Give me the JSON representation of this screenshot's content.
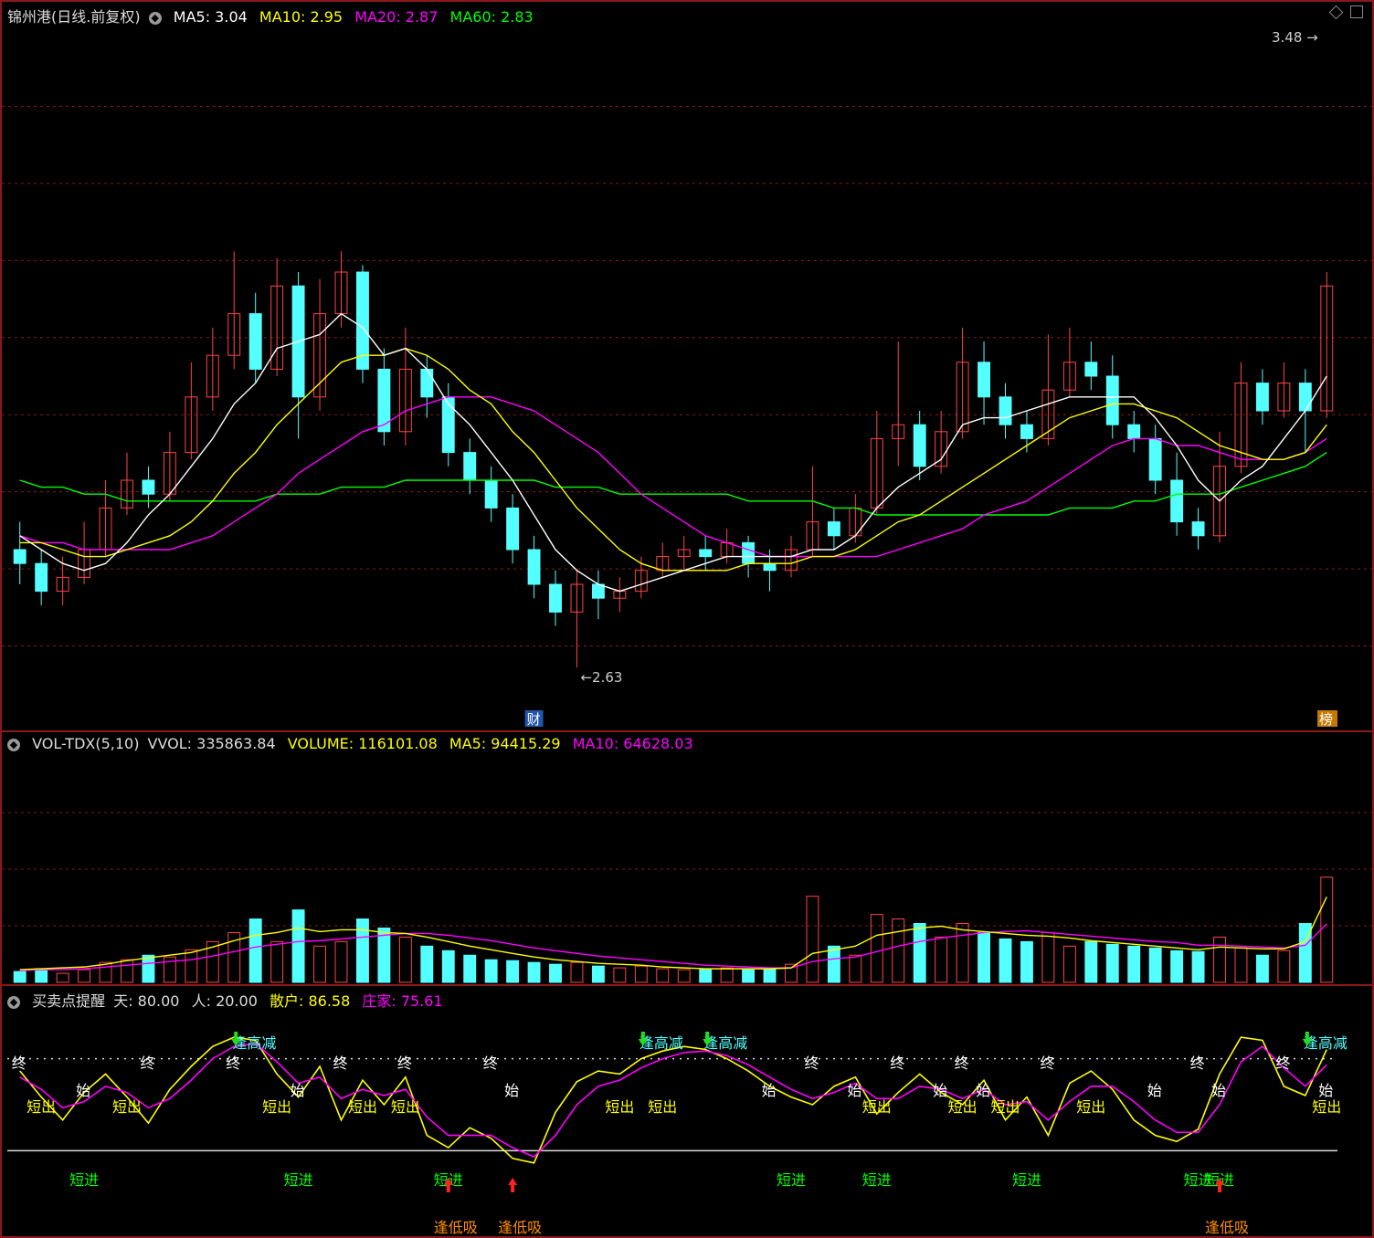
{
  "colors": {
    "up": "#ff4444",
    "down": "#54ffff",
    "ma5": "#ffffff",
    "ma10": "#ffff00",
    "ma20": "#ff00ff",
    "ma60": "#00ff00",
    "grid": "#8a1a1a",
    "vol_ma5": "#ffff00",
    "vol_ma10": "#ff00ff",
    "tian": "#ffff00",
    "ren": "#ff00ff",
    "signal_exit": "#ffff00",
    "signal_entry": "#00ff00",
    "signal_low": "#ff8c00"
  },
  "header": {
    "title": "锦州港(日线.前复权)",
    "ma5": "MA5: 3.04",
    "ma10": "MA10: 2.95",
    "ma20": "MA20: 2.87",
    "ma60": "MA60: 2.83"
  },
  "price_panel": {
    "high_label": "3.48",
    "low_label": "2.63",
    "badge_cai": "财",
    "badge_bang": "榜"
  },
  "volume_header": {
    "name": "VOL-TDX(5,10)",
    "vvol": "VVOL: 335863.84",
    "volume": "VOLUME: 116101.08",
    "ma5": "MA5: 94415.29",
    "ma10": "MA10: 64628.03"
  },
  "indicator_header": {
    "name": "买卖点提醒",
    "tian": "天: 80.00",
    "ren": "人: 20.00",
    "sanhu": "散户: 86.58",
    "zhuangjia": "庄家: 75.61"
  },
  "signal_labels": {
    "exit": "短出",
    "entry": "短进",
    "low_buy": "逢低吸",
    "high_reduce": "逢高减",
    "start": "始",
    "end": "终"
  },
  "chart_data": [
    {
      "type": "candlestick",
      "title": "锦州港(日线.前复权)",
      "ylim": [
        2.55,
        3.55
      ],
      "x_count": 62,
      "candles": [
        [
          2.8,
          2.78,
          2.84,
          2.75
        ],
        [
          2.78,
          2.74,
          2.8,
          2.72
        ],
        [
          2.74,
          2.76,
          2.79,
          2.72
        ],
        [
          2.76,
          2.8,
          2.84,
          2.75
        ],
        [
          2.8,
          2.86,
          2.9,
          2.79
        ],
        [
          2.86,
          2.9,
          2.94,
          2.85
        ],
        [
          2.9,
          2.88,
          2.92,
          2.86
        ],
        [
          2.88,
          2.94,
          2.97,
          2.87
        ],
        [
          2.94,
          3.02,
          3.07,
          2.93
        ],
        [
          3.02,
          3.08,
          3.12,
          3.0
        ],
        [
          3.08,
          3.14,
          3.23,
          3.06
        ],
        [
          3.14,
          3.06,
          3.17,
          3.04
        ],
        [
          3.06,
          3.18,
          3.22,
          3.05
        ],
        [
          3.18,
          3.02,
          3.2,
          2.96
        ],
        [
          3.02,
          3.14,
          3.19,
          3.0
        ],
        [
          3.14,
          3.2,
          3.23,
          3.12
        ],
        [
          3.2,
          3.06,
          3.21,
          3.04
        ],
        [
          3.06,
          2.97,
          3.09,
          2.95
        ],
        [
          2.97,
          3.06,
          3.12,
          2.95
        ],
        [
          3.06,
          3.02,
          3.08,
          2.99
        ],
        [
          3.02,
          2.94,
          3.04,
          2.92
        ],
        [
          2.94,
          2.9,
          2.96,
          2.88
        ],
        [
          2.9,
          2.86,
          2.92,
          2.84
        ],
        [
          2.86,
          2.8,
          2.88,
          2.78
        ],
        [
          2.8,
          2.75,
          2.82,
          2.73
        ],
        [
          2.75,
          2.71,
          2.77,
          2.69
        ],
        [
          2.71,
          2.75,
          2.77,
          2.63
        ],
        [
          2.75,
          2.73,
          2.77,
          2.7
        ],
        [
          2.73,
          2.74,
          2.76,
          2.71
        ],
        [
          2.74,
          2.77,
          2.79,
          2.73
        ],
        [
          2.77,
          2.79,
          2.81,
          2.76
        ],
        [
          2.79,
          2.8,
          2.82,
          2.77
        ],
        [
          2.8,
          2.79,
          2.82,
          2.77
        ],
        [
          2.79,
          2.81,
          2.83,
          2.78
        ],
        [
          2.81,
          2.78,
          2.82,
          2.76
        ],
        [
          2.78,
          2.77,
          2.8,
          2.74
        ],
        [
          2.77,
          2.8,
          2.82,
          2.76
        ],
        [
          2.8,
          2.84,
          2.92,
          2.79
        ],
        [
          2.84,
          2.82,
          2.86,
          2.8
        ],
        [
          2.82,
          2.86,
          2.88,
          2.81
        ],
        [
          2.86,
          2.96,
          3.0,
          2.85
        ],
        [
          2.96,
          2.98,
          3.1,
          2.92
        ],
        [
          2.98,
          2.92,
          3.0,
          2.9
        ],
        [
          2.92,
          2.97,
          3.0,
          2.91
        ],
        [
          2.97,
          3.07,
          3.12,
          2.96
        ],
        [
          3.07,
          3.02,
          3.1,
          2.98
        ],
        [
          3.02,
          2.98,
          3.04,
          2.96
        ],
        [
          2.98,
          2.96,
          3.0,
          2.94
        ],
        [
          2.96,
          3.03,
          3.11,
          2.95
        ],
        [
          3.03,
          3.07,
          3.12,
          3.02
        ],
        [
          3.07,
          3.05,
          3.1,
          3.03
        ],
        [
          3.05,
          2.98,
          3.08,
          2.96
        ],
        [
          2.98,
          2.96,
          3.0,
          2.94
        ],
        [
          2.96,
          2.9,
          2.98,
          2.88
        ],
        [
          2.9,
          2.84,
          2.94,
          2.82
        ],
        [
          2.84,
          2.82,
          2.86,
          2.8
        ],
        [
          2.82,
          2.92,
          2.97,
          2.81
        ],
        [
          2.92,
          3.04,
          3.07,
          2.91
        ],
        [
          3.04,
          3.0,
          3.06,
          2.98
        ],
        [
          3.0,
          3.04,
          3.07,
          2.99
        ],
        [
          3.04,
          3.0,
          3.06,
          2.94
        ],
        [
          3.0,
          3.18,
          3.2,
          2.99
        ]
      ],
      "ma5": [
        2.82,
        2.8,
        2.78,
        2.77,
        2.78,
        2.81,
        2.85,
        2.88,
        2.92,
        2.96,
        3.01,
        3.04,
        3.09,
        3.1,
        3.11,
        3.14,
        3.12,
        3.08,
        3.09,
        3.06,
        3.01,
        2.98,
        2.94,
        2.9,
        2.85,
        2.8,
        2.77,
        2.75,
        2.74,
        2.75,
        2.76,
        2.77,
        2.78,
        2.79,
        2.79,
        2.79,
        2.79,
        2.8,
        2.8,
        2.82,
        2.86,
        2.89,
        2.91,
        2.93,
        2.98,
        2.99,
        2.99,
        3.0,
        3.01,
        3.02,
        3.02,
        3.02,
        3.02,
        2.99,
        2.95,
        2.9,
        2.87,
        2.9,
        2.92,
        2.96,
        3.0,
        3.05
      ],
      "ma10": [
        2.81,
        2.81,
        2.8,
        2.79,
        2.79,
        2.8,
        2.81,
        2.82,
        2.84,
        2.87,
        2.91,
        2.94,
        2.98,
        3.01,
        3.04,
        3.07,
        3.08,
        3.08,
        3.09,
        3.08,
        3.06,
        3.03,
        3.01,
        2.97,
        2.94,
        2.9,
        2.86,
        2.83,
        2.8,
        2.78,
        2.77,
        2.77,
        2.77,
        2.77,
        2.78,
        2.78,
        2.78,
        2.79,
        2.79,
        2.8,
        2.82,
        2.84,
        2.85,
        2.87,
        2.89,
        2.91,
        2.93,
        2.95,
        2.97,
        2.99,
        3.0,
        3.01,
        3.01,
        3.0,
        2.99,
        2.97,
        2.95,
        2.94,
        2.93,
        2.93,
        2.94,
        2.98
      ],
      "ma20": [
        2.82,
        2.81,
        2.81,
        2.8,
        2.8,
        2.8,
        2.8,
        2.8,
        2.81,
        2.82,
        2.84,
        2.86,
        2.88,
        2.91,
        2.93,
        2.95,
        2.97,
        2.98,
        3.0,
        3.01,
        3.02,
        3.02,
        3.02,
        3.01,
        3.0,
        2.98,
        2.96,
        2.94,
        2.91,
        2.88,
        2.86,
        2.84,
        2.82,
        2.81,
        2.8,
        2.79,
        2.79,
        2.79,
        2.79,
        2.79,
        2.79,
        2.8,
        2.81,
        2.82,
        2.83,
        2.85,
        2.86,
        2.87,
        2.89,
        2.91,
        2.93,
        2.95,
        2.96,
        2.96,
        2.95,
        2.95,
        2.94,
        2.93,
        2.93,
        2.93,
        2.94,
        2.96
      ],
      "ma60": [
        2.9,
        2.89,
        2.89,
        2.88,
        2.88,
        2.87,
        2.87,
        2.87,
        2.87,
        2.87,
        2.87,
        2.87,
        2.88,
        2.88,
        2.88,
        2.89,
        2.89,
        2.89,
        2.9,
        2.9,
        2.9,
        2.9,
        2.9,
        2.9,
        2.9,
        2.89,
        2.89,
        2.89,
        2.88,
        2.88,
        2.88,
        2.88,
        2.88,
        2.88,
        2.87,
        2.87,
        2.87,
        2.87,
        2.86,
        2.86,
        2.85,
        2.85,
        2.85,
        2.85,
        2.85,
        2.85,
        2.85,
        2.85,
        2.85,
        2.86,
        2.86,
        2.86,
        2.87,
        2.87,
        2.88,
        2.88,
        2.88,
        2.89,
        2.9,
        2.91,
        2.92,
        2.94
      ]
    },
    {
      "type": "bar",
      "title": "VOL-TDX(5,10)",
      "ylim": [
        0,
        250000
      ],
      "volume": [
        12000,
        15000,
        10000,
        14000,
        22000,
        25000,
        30000,
        28000,
        36000,
        45000,
        55000,
        70000,
        45000,
        80000,
        40000,
        45000,
        70000,
        60000,
        50000,
        40000,
        35000,
        30000,
        25000,
        24000,
        22000,
        20000,
        22000,
        18000,
        16000,
        18000,
        15000,
        14000,
        15000,
        16000,
        14000,
        15000,
        20000,
        95000,
        40000,
        30000,
        75000,
        70000,
        65000,
        50000,
        65000,
        55000,
        48000,
        45000,
        55000,
        40000,
        45000,
        42000,
        40000,
        38000,
        35000,
        34000,
        50000,
        38000,
        30000,
        35000,
        65000,
        116101
      ],
      "ma5": [
        14000,
        15000,
        16000,
        17000,
        20000,
        24000,
        27000,
        30000,
        33000,
        39000,
        46000,
        52000,
        55000,
        60000,
        56000,
        58000,
        58000,
        55000,
        54000,
        50000,
        45000,
        40000,
        36000,
        32000,
        28000,
        25000,
        23000,
        21000,
        20000,
        19000,
        17000,
        16000,
        15000,
        15000,
        15000,
        15000,
        16000,
        32000,
        36000,
        40000,
        52000,
        56000,
        60000,
        62000,
        58000,
        56000,
        54000,
        52000,
        51000,
        49000,
        46000,
        44000,
        42000,
        40000,
        38000,
        36000,
        39000,
        38000,
        37000,
        37000,
        45000,
        94415
      ],
      "ma10": [
        13000,
        14000,
        14000,
        15000,
        17000,
        19000,
        21000,
        23000,
        25000,
        29000,
        34000,
        39000,
        42000,
        45000,
        46000,
        48000,
        50000,
        52000,
        54000,
        54000,
        52000,
        49000,
        46000,
        42000,
        38000,
        35000,
        32000,
        29000,
        27000,
        25000,
        23000,
        21000,
        19000,
        18000,
        17000,
        16000,
        16000,
        23000,
        26000,
        28000,
        34000,
        40000,
        45000,
        49000,
        52000,
        55000,
        56000,
        57000,
        55000,
        53000,
        51000,
        49000,
        47000,
        45000,
        44000,
        41000,
        41000,
        40000,
        39000,
        38000,
        41000,
        64628
      ]
    },
    {
      "type": "line",
      "title": "买卖点提醒",
      "ylim": [
        0,
        100
      ],
      "series": [
        {
          "name": "散户",
          "values": [
            72,
            55,
            40,
            58,
            70,
            55,
            38,
            60,
            75,
            88,
            94,
            92,
            70,
            55,
            75,
            40,
            66,
            50,
            68,
            30,
            22,
            35,
            28,
            15,
            12,
            45,
            65,
            72,
            70,
            80,
            85,
            88,
            86,
            80,
            72,
            62,
            55,
            50,
            62,
            68,
            44,
            58,
            70,
            58,
            50,
            66,
            40,
            55,
            30,
            64,
            72,
            60,
            40,
            30,
            26,
            34,
            70,
            94,
            92,
            62,
            56,
            86
          ]
        },
        {
          "name": "庄家",
          "values": [
            68,
            60,
            48,
            52,
            62,
            58,
            48,
            54,
            66,
            80,
            88,
            90,
            78,
            64,
            68,
            54,
            60,
            56,
            60,
            42,
            30,
            30,
            30,
            22,
            16,
            30,
            50,
            62,
            66,
            74,
            80,
            84,
            85,
            82,
            76,
            68,
            60,
            54,
            58,
            64,
            54,
            54,
            62,
            60,
            54,
            60,
            50,
            52,
            40,
            52,
            62,
            62,
            52,
            40,
            32,
            32,
            50,
            78,
            88,
            74,
            62,
            76
          ]
        }
      ],
      "reference_lines": [
        80,
        20
      ]
    }
  ]
}
